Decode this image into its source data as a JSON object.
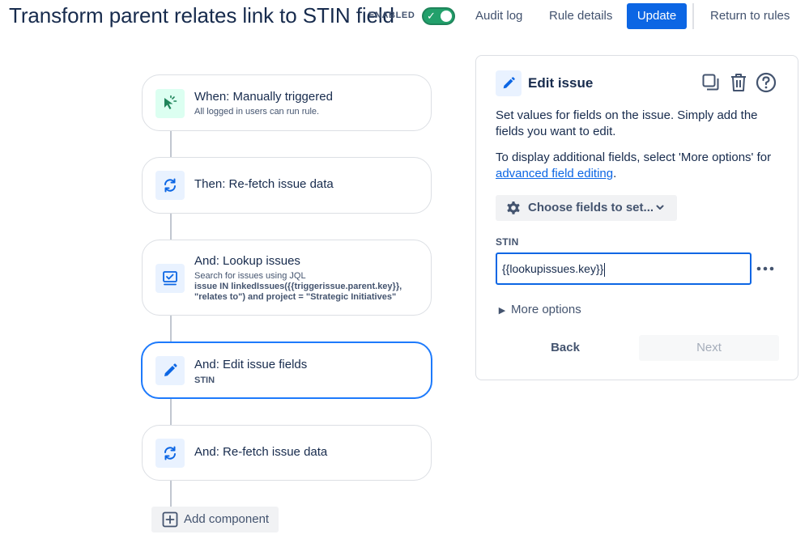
{
  "header": {
    "title": "Transform parent relates link to STIN field",
    "enabled_label": "ENABLED",
    "toggle_on": true,
    "audit_log": "Audit log",
    "rule_details": "Rule details",
    "update": "Update",
    "return": "Return to rules"
  },
  "flow": {
    "trigger": {
      "title": "When: Manually triggered",
      "subtitle": "All logged in users can run rule.",
      "icon": "cursor-click-icon"
    },
    "step1": {
      "title": "Then: Re-fetch issue data",
      "icon": "refresh-icon"
    },
    "step2": {
      "title": "And: Lookup issues",
      "subtitle": "Search for issues using JQL",
      "jql": "issue IN linkedIssues({{triggerissue.parent.key}}, \"relates to\") and project = \"Strategic Initiatives\"",
      "icon": "lookup-icon"
    },
    "step3": {
      "title": "And: Edit issue fields",
      "subtitle": "STIN",
      "icon": "pencil-icon"
    },
    "step4": {
      "title": "And: Re-fetch issue data",
      "icon": "refresh-icon"
    },
    "add_component": "Add component"
  },
  "panel": {
    "title": "Edit issue",
    "desc1": "Set values for fields on the issue. Simply add the fields you want to edit.",
    "desc2_prefix": "To display additional fields, select 'More options' for ",
    "desc2_link": "advanced field editing",
    "desc2_suffix": ".",
    "choose_fields": "Choose fields to set...",
    "field_label": "STIN",
    "field_value": "{{lookupissues.key}}",
    "more_options": "More options",
    "back": "Back",
    "next": "Next"
  },
  "colors": {
    "accent": "#0c66e4",
    "toggle": "#22a06b",
    "selected_border": "#1d7afc"
  }
}
